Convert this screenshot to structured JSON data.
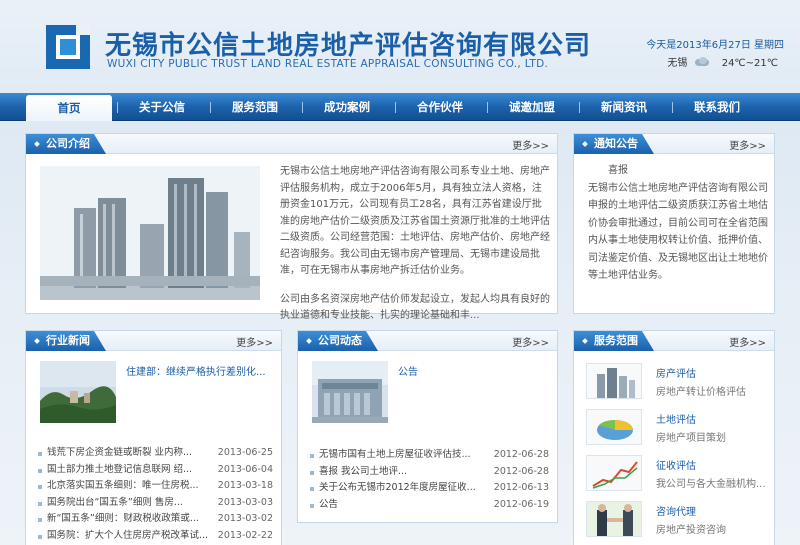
{
  "header": {
    "company_cn": "无锡市公信土地房地产评估咨询有限公司",
    "company_en": "WUXI CITY PUBLIC TRUST LAND REAL ESTATE APPRAISAL CONSULTING CO., LTD.",
    "date": "今天是2013年6月27日 星期四",
    "weather_city": "无锡",
    "weather_temp": "24℃~21℃"
  },
  "nav": [
    "首页",
    "关于公信",
    "服务范围",
    "成功案例",
    "合作伙伴",
    "诚邀加盟",
    "新闻资讯",
    "联系我们"
  ],
  "more_label": "更多>>",
  "intro": {
    "title": "公司介绍",
    "p1": "无锡市公信土地房地产评估咨询有限公司系专业土地、房地产评估服务机构，成立于2006年5月，具有独立法人资格，注册资金101万元，公司现有员工28名，具有江苏省建设厅批准的房地产估价二级资质及江苏省国土资源厅批准的土地评估二级资质。公司经营范围：土地评估、房地产估价、房地产经纪咨询服务。我公司由无锡市房产管理局、无锡市建设局批准，可在无锡市从事房地产拆迁估价业务。",
    "p2": "公司由多名资深房地产估价师发起设立，发起人均具有良好的执业道德和专业技能、扎实的理论基础和丰..."
  },
  "notice": {
    "title": "通知公告",
    "heading": "喜报",
    "body": "无锡市公信土地房地产评估咨询有限公司申报的土地评估二级资质获江苏省土地估价协会审批通过，目前公司可在全省范围内从事土地使用权转让价值、抵押价值、司法鉴定价值、及无锡地区出让土地地价等土地评估业务。"
  },
  "industry": {
    "title": "行业新闻",
    "feature": "住建部：继续严格执行差别化...",
    "items": [
      {
        "t": "钱荒下房企资金链或断裂 业内称...",
        "d": "2013-06-25"
      },
      {
        "t": "国土部力推土地登记信息联网 绍...",
        "d": "2013-06-04"
      },
      {
        "t": "北京落实国五条细则：唯一住房税...",
        "d": "2013-03-18"
      },
      {
        "t": "国务院出台“国五条”细则 售房...",
        "d": "2013-03-03"
      },
      {
        "t": "新“国五条”细则：财政税收政策或...",
        "d": "2013-03-02"
      },
      {
        "t": "国务院：扩大个人住房房产税改革试...",
        "d": "2013-02-22"
      }
    ]
  },
  "company_news": {
    "title": "公司动态",
    "feature": "公告",
    "items": [
      {
        "t": "无锡市国有土地上房屋征收评估技...",
        "d": "2012-06-28"
      },
      {
        "t": "喜报  我公司土地评...",
        "d": "2012-06-28"
      },
      {
        "t": "关于公布无锡市2012年度房屋征收...",
        "d": "2012-06-13"
      },
      {
        "t": "公告",
        "d": "2012-06-19"
      }
    ]
  },
  "services": {
    "title": "服务范围",
    "items": [
      {
        "t": "房产评估",
        "s": "房地产转让价格评估"
      },
      {
        "t": "土地评估",
        "s": "房地产项目策划"
      },
      {
        "t": "征收评估",
        "s": "我公司与各大金融机构..."
      },
      {
        "t": "咨询代理",
        "s": "房地产投资咨询"
      }
    ]
  }
}
